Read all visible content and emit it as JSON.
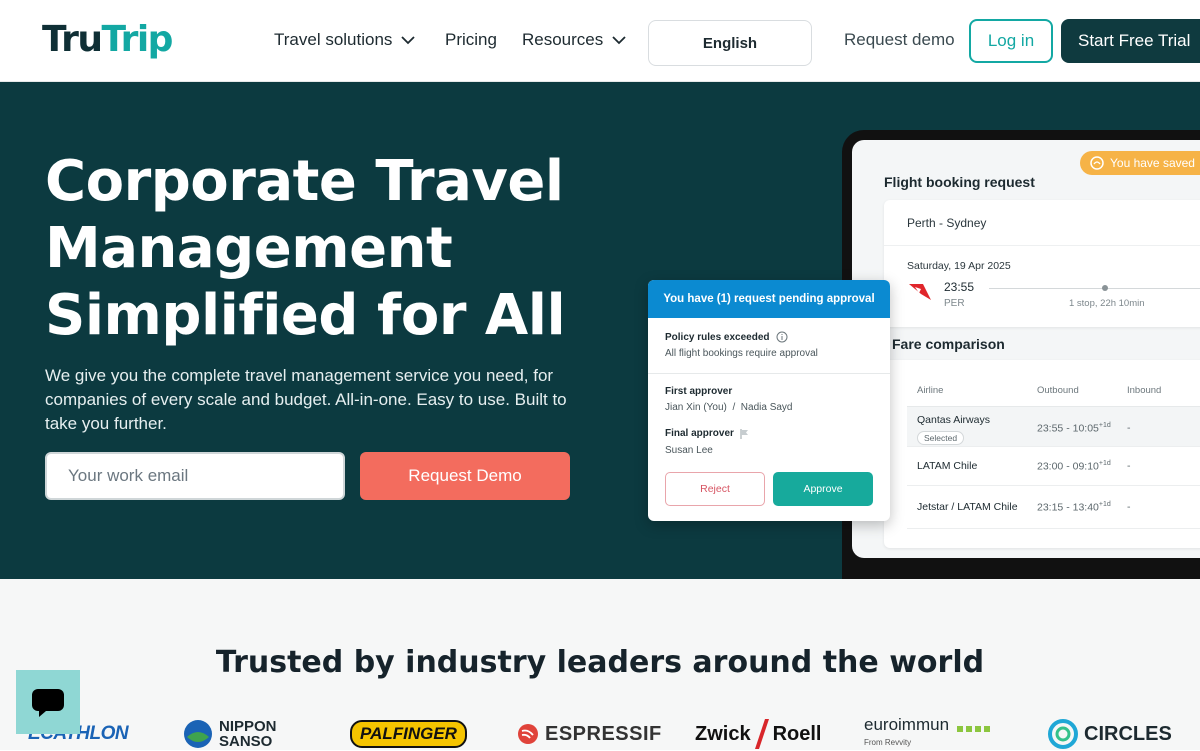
{
  "header": {
    "logo": {
      "part1": "Tru",
      "part2": "Trip"
    },
    "nav": [
      {
        "label": "Travel solutions",
        "has_dropdown": true
      },
      {
        "label": "Pricing",
        "has_dropdown": false
      },
      {
        "label": "Resources",
        "has_dropdown": true
      }
    ],
    "language": "English",
    "request_demo": "Request demo",
    "login": "Log in",
    "start_trial": "Start Free Trial"
  },
  "hero": {
    "title_lines": [
      "Corporate Travel",
      "Management",
      "Simplified for All"
    ],
    "subtitle": "We give you the complete travel management service you need, for companies of every scale and budget. All-in-one. Easy to use. Built to take you further.",
    "email_placeholder": "Your work email",
    "cta": "Request Demo"
  },
  "mockup": {
    "saved_pill": "You have saved",
    "booking_title": "Flight booking request",
    "route": "Perth - Sydney",
    "date": "Saturday, 19 Apr 2025",
    "depart_time": "23:55",
    "depart_code": "PER",
    "stops": "1 stop, 22h 10min",
    "fare_title": "Fare comparison",
    "fare_headers": [
      "Airline",
      "Outbound",
      "Inbound"
    ],
    "fares": [
      {
        "airline": "Qantas Airways",
        "badge": "Selected",
        "outbound": "23:55 - 10:05",
        "plus": "+1d",
        "inbound": "-"
      },
      {
        "airline": "LATAM Chile",
        "badge": "",
        "outbound": "23:00 - 09:10",
        "plus": "+1d",
        "inbound": "-"
      },
      {
        "airline": "Jetstar / LATAM Chile",
        "badge": "",
        "outbound": "23:15 - 13:40",
        "plus": "+1d",
        "inbound": "-"
      }
    ]
  },
  "approval": {
    "header": "You have (1) request pending approval",
    "policy_title": "Policy rules exceeded",
    "policy_text": "All flight bookings require approval",
    "first_label": "First approver",
    "first_names": "Jian Xin (You)  /  Nadia Sayd",
    "final_label": "Final approver",
    "final_name": "Susan Lee",
    "reject": "Reject",
    "approve": "Approve"
  },
  "trusted": {
    "title": "Trusted by industry leaders around the world",
    "logos": [
      {
        "name": "DECATHLON",
        "visible": "ECATHLON",
        "color": "#1a63b5"
      },
      {
        "name": "NIPPON SANSO",
        "line1": "NIPPON",
        "line2": "SANSO",
        "color": "#1d2a30"
      },
      {
        "name": "PALFINGER",
        "color": "#111111",
        "bg": "#f5c400"
      },
      {
        "name": "ESPRESSIF",
        "color": "#333333",
        "accent": "#e0433a"
      },
      {
        "name": "Zwick Roell",
        "left": "Zwick",
        "right": "Roell",
        "color": "#111111",
        "accent": "#d8262a"
      },
      {
        "name": "euroimmun",
        "sub": "From Revvity",
        "color": "#1d2a30",
        "accent": "#8cc63f"
      },
      {
        "name": "CIRCLES",
        "color": "#1d2a30",
        "accent": "#1fa7d6"
      }
    ]
  },
  "chat": {
    "icon": "chat-icon"
  },
  "colors": {
    "brand_dark": "#0c3a40",
    "brand_teal": "#13a8a3",
    "cta_coral": "#f36c5e",
    "approval_blue": "#0b8ad1"
  }
}
